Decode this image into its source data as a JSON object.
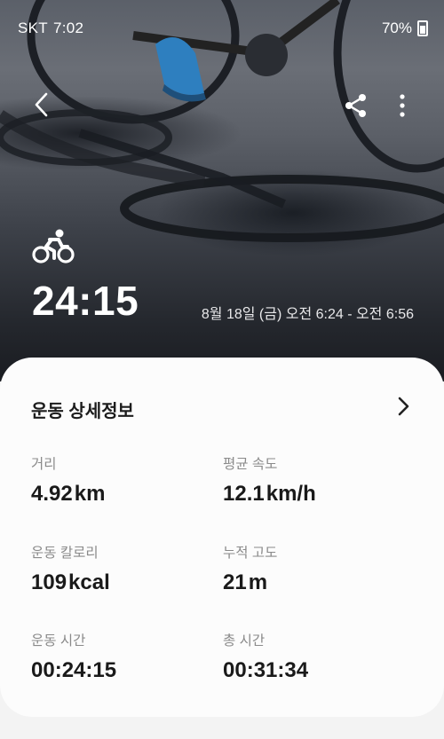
{
  "status_bar": {
    "carrier": "SKT",
    "time": "7:02",
    "battery": "70%"
  },
  "hero": {
    "duration": "24:15",
    "date_range": "8월 18일 (금) 오전 6:24 - 오전 6:56"
  },
  "icons": {
    "back": "chevron-left-icon",
    "share": "share-icon",
    "more": "more-vertical-icon",
    "activity": "cycling-icon",
    "detail": "chevron-right-icon"
  },
  "details": {
    "title": "운동 상세정보",
    "stats": [
      {
        "label": "거리",
        "value": "4.92",
        "unit": "km"
      },
      {
        "label": "평균 속도",
        "value": "12.1",
        "unit": "km/h"
      },
      {
        "label": "운동 칼로리",
        "value": "109",
        "unit": "kcal"
      },
      {
        "label": "누적 고도",
        "value": "21",
        "unit": "m"
      },
      {
        "label": "운동 시간",
        "value": "00:24:15",
        "unit": ""
      },
      {
        "label": "총 시간",
        "value": "00:31:34",
        "unit": ""
      }
    ]
  }
}
